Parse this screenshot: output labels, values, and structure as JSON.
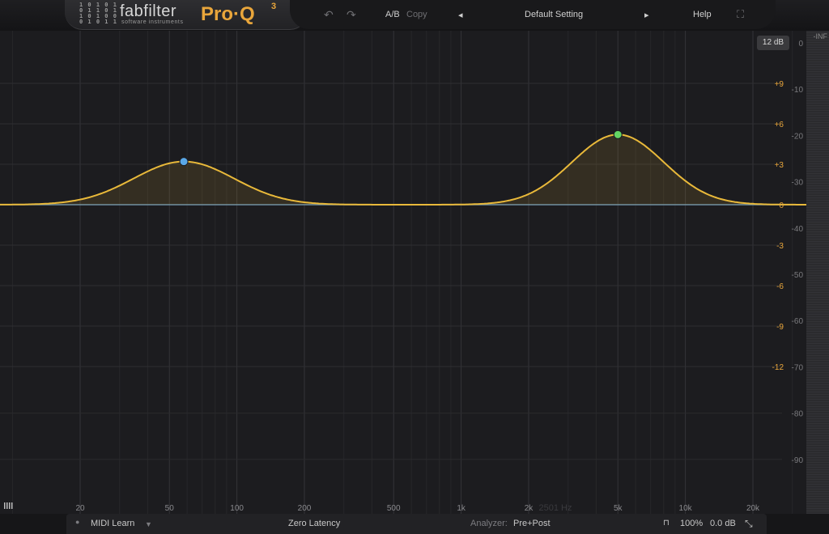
{
  "logo": {
    "bits": [
      "1 0 1 0 1",
      "0 1 1 0 1",
      "1 0 1 0 0",
      "0 1 0 1 1"
    ],
    "brand": "fabfilter",
    "brand_sub": "software instruments",
    "product": "Pro·Q",
    "product_version": "3"
  },
  "toolbar": {
    "undo_icon": "↶",
    "redo_icon": "↷",
    "ab_label": "A/B",
    "copy_label": "Copy",
    "prev_icon": "◂",
    "preset_name": "Default Setting",
    "next_icon": "▸",
    "help_label": "Help",
    "fullscreen_icon": "⛶"
  },
  "range_badge": "12 dB",
  "eq_gain_labels": [
    {
      "db": 9,
      "text": "+9"
    },
    {
      "db": 6,
      "text": "+6"
    },
    {
      "db": 3,
      "text": "+3"
    },
    {
      "db": 0,
      "text": "0"
    },
    {
      "db": -3,
      "text": "-3"
    },
    {
      "db": -6,
      "text": "-6"
    },
    {
      "db": -9,
      "text": "-9"
    },
    {
      "db": -12,
      "text": "-12"
    }
  ],
  "analyzer_labels": [
    {
      "db": 0,
      "text": "0"
    },
    {
      "db": -10,
      "text": "-10"
    },
    {
      "db": -20,
      "text": "-20"
    },
    {
      "db": -30,
      "text": "-30"
    },
    {
      "db": -40,
      "text": "-40"
    },
    {
      "db": -50,
      "text": "-50"
    },
    {
      "db": -60,
      "text": "-60"
    },
    {
      "db": -70,
      "text": "-70"
    },
    {
      "db": -80,
      "text": "-80"
    },
    {
      "db": -90,
      "text": "-90"
    }
  ],
  "meter_top_label": "-INF",
  "freq_labels": [
    {
      "hz": 20,
      "text": "20"
    },
    {
      "hz": 50,
      "text": "50"
    },
    {
      "hz": 100,
      "text": "100"
    },
    {
      "hz": 200,
      "text": "200"
    },
    {
      "hz": 500,
      "text": "500"
    },
    {
      "hz": 1000,
      "text": "1k"
    },
    {
      "hz": 2000,
      "text": "2k"
    },
    {
      "hz": 5000,
      "text": "5k"
    },
    {
      "hz": 10000,
      "text": "10k"
    },
    {
      "hz": 20000,
      "text": "20k"
    }
  ],
  "hover_freq_label": "2501 Hz",
  "bands": [
    {
      "freq": 58,
      "gain": 3.2,
      "q": 1.0,
      "color": "#5aa8e8"
    },
    {
      "freq": 5000,
      "gain": 5.2,
      "q": 1.2,
      "color": "#63d463"
    }
  ],
  "colors": {
    "curve": "#e9b93a",
    "zero_line": "#6a8fa8",
    "accent": "#e9a63b"
  },
  "bottom": {
    "piano_icon": "piano-keys",
    "midi_learn_label": "MIDI Learn",
    "latency_label": "Zero Latency",
    "analyzer_label": "Analyzer:",
    "analyzer_value": "Pre+Post",
    "zoom_value": "100%",
    "output_gain": "0.0 dB",
    "resize_icon": "⤡"
  }
}
